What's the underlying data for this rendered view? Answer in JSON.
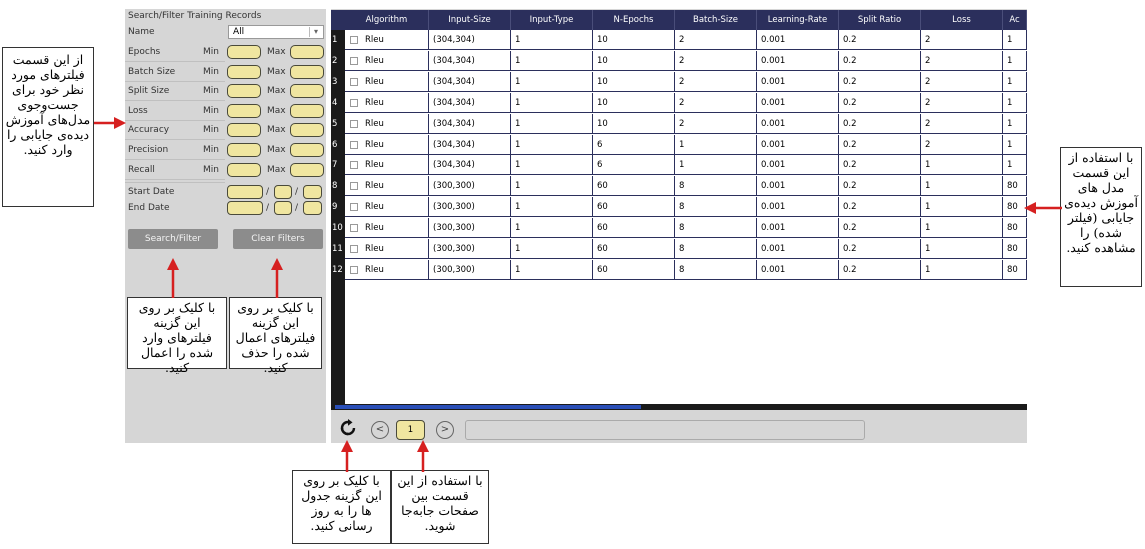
{
  "filter_panel": {
    "title": "Search/Filter Training Records",
    "name_label": "Name",
    "name_value": "All",
    "min_label": "Min",
    "max_label": "Max",
    "fields": [
      {
        "label": "Epochs"
      },
      {
        "label": "Batch Size"
      },
      {
        "label": "Split Size"
      },
      {
        "label": "Loss"
      },
      {
        "label": "Accuracy"
      },
      {
        "label": "Precision"
      },
      {
        "label": "Recall"
      }
    ],
    "start_date_label": "Start Date",
    "end_date_label": "End Date",
    "date_separator": "/",
    "search_button": "Search/Filter",
    "clear_button": "Clear Filters"
  },
  "table": {
    "columns": [
      "Algorithm",
      "Input-Size",
      "Input-Type",
      "N-Epochs",
      "Batch-Size",
      "Learning-Rate",
      "Split Ratio",
      "Loss",
      "Ac"
    ],
    "rows": [
      {
        "n": "1",
        "cells": [
          "Rleu",
          "(304,304)",
          "1",
          "10",
          "2",
          "0.001",
          "0.2",
          "2",
          "1"
        ]
      },
      {
        "n": "2",
        "cells": [
          "Rleu",
          "(304,304)",
          "1",
          "10",
          "2",
          "0.001",
          "0.2",
          "2",
          "1"
        ]
      },
      {
        "n": "3",
        "cells": [
          "Rleu",
          "(304,304)",
          "1",
          "10",
          "2",
          "0.001",
          "0.2",
          "2",
          "1"
        ]
      },
      {
        "n": "4",
        "cells": [
          "Rleu",
          "(304,304)",
          "1",
          "10",
          "2",
          "0.001",
          "0.2",
          "2",
          "1"
        ]
      },
      {
        "n": "5",
        "cells": [
          "Rleu",
          "(304,304)",
          "1",
          "10",
          "2",
          "0.001",
          "0.2",
          "2",
          "1"
        ]
      },
      {
        "n": "6",
        "cells": [
          "Rleu",
          "(304,304)",
          "1",
          "6",
          "1",
          "0.001",
          "0.2",
          "2",
          "1"
        ]
      },
      {
        "n": "7",
        "cells": [
          "Rleu",
          "(304,304)",
          "1",
          "6",
          "1",
          "0.001",
          "0.2",
          "1",
          "1"
        ]
      },
      {
        "n": "8",
        "cells": [
          "Rleu",
          "(300,300)",
          "1",
          "60",
          "8",
          "0.001",
          "0.2",
          "1",
          "80"
        ]
      },
      {
        "n": "9",
        "cells": [
          "Rleu",
          "(300,300)",
          "1",
          "60",
          "8",
          "0.001",
          "0.2",
          "1",
          "80"
        ]
      },
      {
        "n": "10",
        "cells": [
          "Rleu",
          "(300,300)",
          "1",
          "60",
          "8",
          "0.001",
          "0.2",
          "1",
          "80"
        ]
      },
      {
        "n": "11",
        "cells": [
          "Rleu",
          "(300,300)",
          "1",
          "60",
          "8",
          "0.001",
          "0.2",
          "1",
          "80"
        ]
      },
      {
        "n": "12",
        "cells": [
          "Rleu",
          "(300,300)",
          "1",
          "60",
          "8",
          "0.001",
          "0.2",
          "1",
          "80"
        ]
      }
    ]
  },
  "pager": {
    "page": "1",
    "prev_icon": "chevron-left-icon",
    "next_icon": "chevron-right-icon",
    "refresh_icon": "refresh-icon"
  },
  "annotations": {
    "filters": "از این قسمت فیلترهای مورد نظر خود برای جست‌وجوی مدل‌های آموزش دیده‌ی جایابی را وارد کنید.",
    "search": "با کلیک بر روی این گزینه فیلترهای وارد شده را اعمال کنید.",
    "clear": "با کلیک بر روی این گزینه فیلترهای اعمال شده را حذف کنید.",
    "refresh": "با کلیک بر روی این گزینه جدول ها را به روز رسانی کنید.",
    "pages": "با استفاده از این قسمت بین صفحات جابه‌جا شوید.",
    "table": "با استفاده از این قسمت مدل های آموزش دیده‌ی جایابی (فیلتر شده) را مشاهده کنید."
  },
  "colors": {
    "header": "#2b2f5c",
    "input_fill": "#f0e6a0",
    "arrow": "#d62020",
    "panel": "#d6d6d6"
  }
}
